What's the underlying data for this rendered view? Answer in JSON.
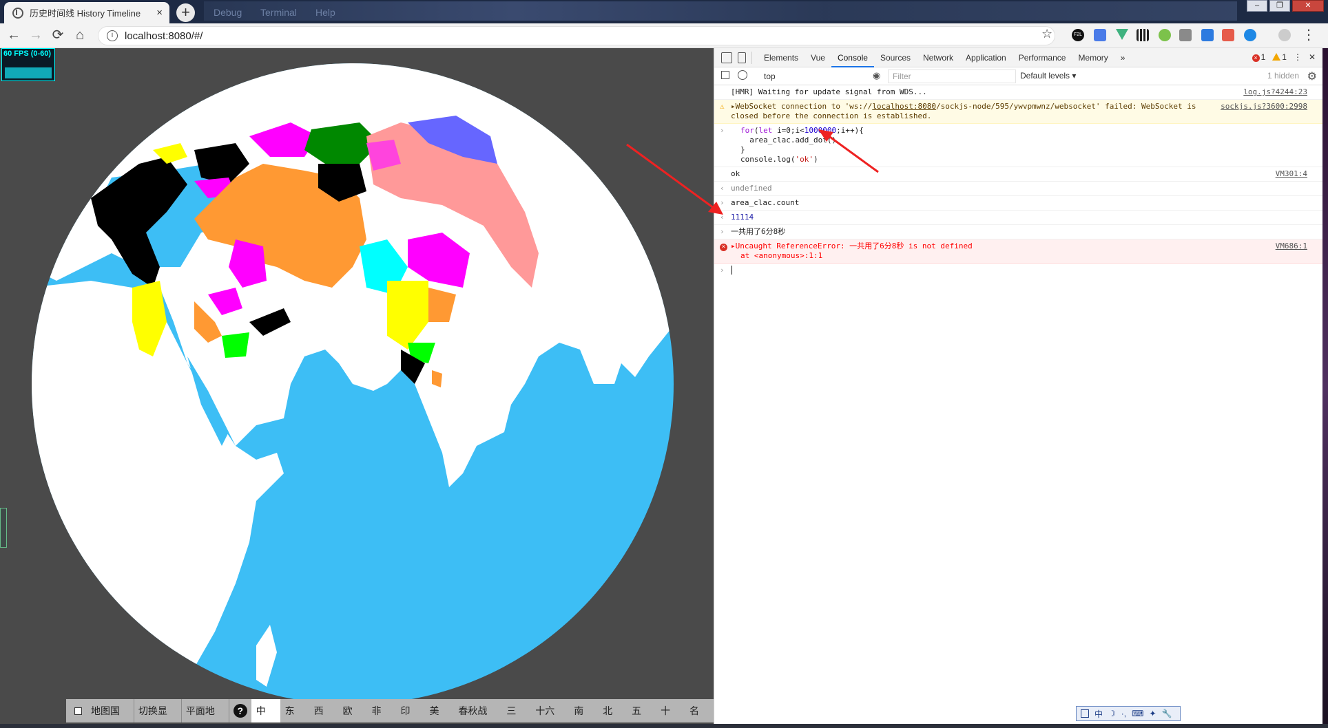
{
  "browser": {
    "tab_title": "历史时间线 History Timeline",
    "tab_close": "×",
    "new_tab": "+",
    "ghost_menu": [
      "Debug",
      "Terminal",
      "Help"
    ],
    "window_controls": [
      "–",
      "❐",
      "✕"
    ],
    "nav": {
      "back": "←",
      "forward": "→",
      "reload": "⟳",
      "home": "⌂"
    },
    "address": "localhost:8080/#/",
    "info_icon": "i",
    "bookmark_star": "☆",
    "menu_dots": "⋮",
    "extension_badge": "F2L"
  },
  "page": {
    "fps_label": "60 FPS (0-60)",
    "bottom_bar": {
      "toggles": [
        "地图国名",
        "切换显示",
        "平面地图"
      ],
      "help": "?",
      "eras": [
        "中国",
        "东亚",
        "西亚",
        "欧洲",
        "非洲",
        "印度",
        "美洲",
        "春秋战国",
        "三国",
        "十六国",
        "南朝",
        "北朝",
        "五代",
        "十国",
        "名人"
      ],
      "active_era": "中国"
    },
    "colors": {
      "ocean": "#3dbef5",
      "land": "#ffffff",
      "background": "#4a4a4a"
    }
  },
  "devtools": {
    "tabs": [
      "Elements",
      "Vue",
      "Console",
      "Sources",
      "Network",
      "Application",
      "Performance",
      "Memory"
    ],
    "active_tab": "Console",
    "more_tabs": "»",
    "error_count": "1",
    "warning_count": "1",
    "menu": "⋮",
    "close": "✕",
    "context": "top",
    "filter_placeholder": "Filter",
    "levels": "Default levels ▾",
    "hidden_count": "1 hidden",
    "console": {
      "hmr": {
        "text": "[HMR] Waiting for update signal from WDS...",
        "src": "log.js?4244:23"
      },
      "warning": {
        "prefix": "▸WebSocket connection to 'ws://",
        "link": "localhost:8080",
        "rest": "/sockjs-node/595/ywvpmwnz/websocket' failed: WebSocket is closed before the connection is established.",
        "src": "sockjs.js?3600:2998"
      },
      "input1": {
        "kw_for": "for",
        "head_a": "(",
        "kw_let": "let",
        "head_b": " i=0;i<",
        "num": "1000000",
        "head_c": ";i++){",
        "line2": "  area_clac.add_dot()",
        "line3": "}",
        "line4_a": "console.log(",
        "line4_str": "'ok'",
        "line4_b": ")"
      },
      "log_ok": {
        "text": "ok",
        "src": "VM301:4"
      },
      "return1": "undefined",
      "input2": "area_clac.count",
      "return2": "11114",
      "input3": "一共用了6分8秒",
      "error": {
        "text": "▸Uncaught ReferenceError: 一共用了6分8秒 is not defined",
        "trace": "at <anonymous>:1:1",
        "src": "VM686:1"
      },
      "prompt": "›",
      "prompt_in": "›",
      "prompt_out": "‹"
    }
  },
  "ime": {
    "items": [
      "中",
      "☽",
      "·,",
      "⌨",
      "✦",
      "🔧"
    ]
  }
}
